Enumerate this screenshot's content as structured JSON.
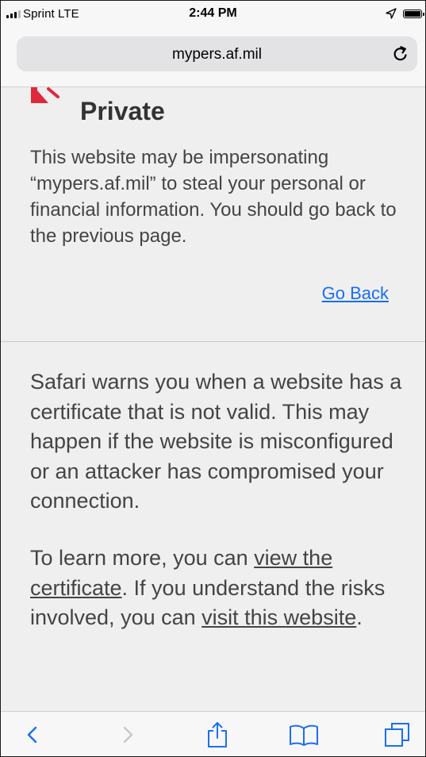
{
  "status_bar": {
    "carrier": "Sprint  LTE",
    "time": "2:44 PM",
    "icons": [
      "signal-icon",
      "location-arrow-icon",
      "battery-icon"
    ]
  },
  "address_bar": {
    "url": "mypers.af.mil",
    "reload_icon": "reload-icon"
  },
  "warning": {
    "title": "Private",
    "message": "This website may be impersonating “mypers.af.mil” to steal your personal or financial information. You should go back to the previous page.",
    "go_back_label": "Go Back"
  },
  "details": {
    "info": "Safari warns you when a website has a certificate that is not valid. This may happen if the website is misconfigured or an attacker has compromised your connection.",
    "learn_prefix": "To learn more, you can ",
    "view_certificate_link": "view the certificate",
    "learn_middle": ". If you understand the risks involved, you can ",
    "visit_website_link": "visit this website",
    "learn_suffix": "."
  },
  "toolbar": {
    "buttons": [
      "back-icon",
      "forward-icon",
      "share-icon",
      "bookmarks-icon",
      "tabs-icon"
    ]
  },
  "colors": {
    "link_blue": "#1a6ef5",
    "warning_red": "#e0283c",
    "disabled_gray": "#c7c7cc",
    "toolbar_blue": "#1a6ef5"
  }
}
